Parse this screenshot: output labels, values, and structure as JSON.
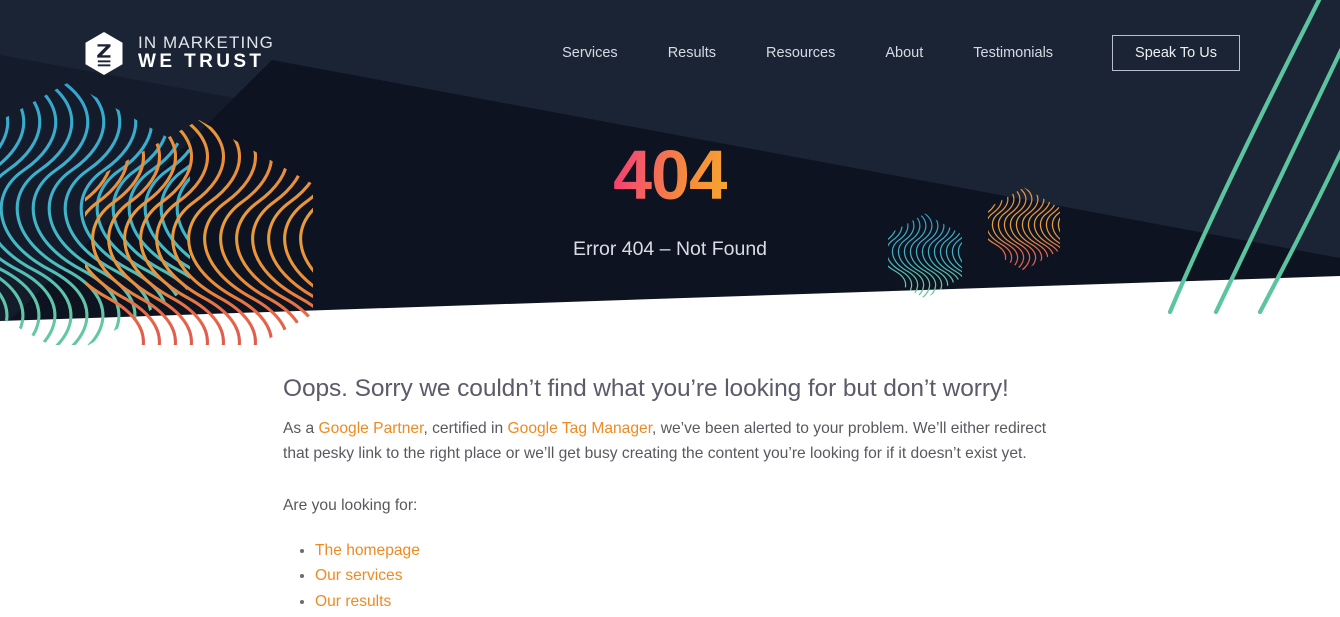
{
  "brand": {
    "line1": "IN MARKETING",
    "line2": "WE TRUST",
    "mark_icon": "hexagon-z-logo-icon"
  },
  "nav": {
    "items": [
      {
        "label": "Services"
      },
      {
        "label": "Results"
      },
      {
        "label": "Resources"
      },
      {
        "label": "About"
      },
      {
        "label": "Testimonials"
      }
    ],
    "cta_label": "Speak To Us"
  },
  "hero": {
    "error_code": "404",
    "error_subtitle": "Error 404 – Not Found",
    "bg_color": "#141c2b",
    "bg_color_light": "#1b2434",
    "bg_color_dark": "#0d1320",
    "code_gradient_from": "#f0396a",
    "code_gradient_to": "#f6a62f",
    "curve_color": "#5cc5a0"
  },
  "decor": {
    "hex_blue_large": "hexagon-fingerprint-blue-icon",
    "hex_orange_large": "hexagon-fingerprint-orange-icon",
    "hex_blue_small": "hexagon-fingerprint-blue-small-icon",
    "hex_orange_small": "hexagon-fingerprint-orange-small-icon",
    "curves": "teal-curve-lines-icon"
  },
  "content": {
    "lead": "Oops. Sorry we couldn’t find what you’re looking for but don’t worry!",
    "paragraph": {
      "part1": "As a ",
      "link1": "Google Partner",
      "part2": ", certified in ",
      "link2": "Google Tag Manager",
      "part3": ", we’ve been alerted to your problem. We’ll either redirect that pesky link to the right place or we’ll get busy creating the content you’re looking for if it doesn’t exist yet."
    },
    "prompt": "Are you looking for:",
    "links": [
      {
        "label": "The homepage"
      },
      {
        "label": "Our services"
      },
      {
        "label": "Our results"
      }
    ],
    "link_color": "#ef8a22",
    "text_color": "#58585f"
  }
}
